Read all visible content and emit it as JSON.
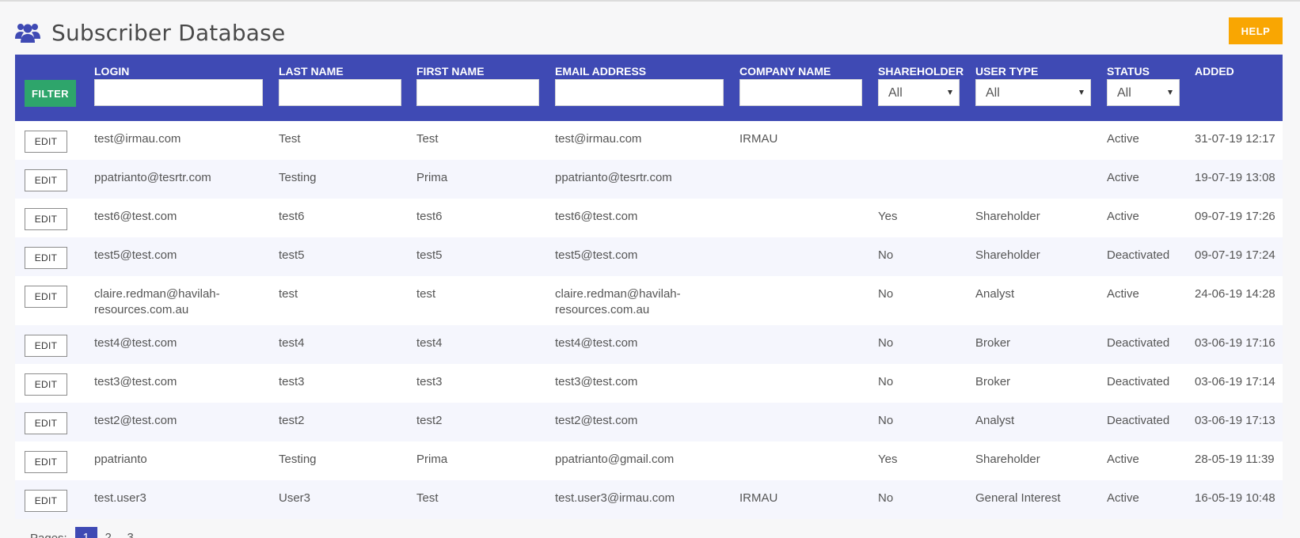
{
  "page": {
    "title": "Subscriber Database",
    "help_label": "HELP",
    "accent_color": "#3f4ab4",
    "filter_color": "#2ea56b",
    "help_color": "#f9a602"
  },
  "filters": {
    "filter_label": "FILTER",
    "columns": {
      "login": "LOGIN",
      "last_name": "LAST NAME",
      "first_name": "FIRST NAME",
      "email": "EMAIL ADDRESS",
      "company": "COMPANY NAME",
      "shareholder": "SHAREHOLDER",
      "user_type": "USER TYPE",
      "status": "STATUS",
      "added": "ADDED"
    },
    "values": {
      "login": "",
      "last_name": "",
      "first_name": "",
      "email": "",
      "company": "",
      "shareholder": "All",
      "user_type": "All",
      "status": "All"
    }
  },
  "table": {
    "edit_label": "EDIT",
    "rows": [
      {
        "login": "test@irmau.com",
        "last_name": "Test",
        "first_name": "Test",
        "email": "test@irmau.com",
        "company": "IRMAU",
        "shareholder": "",
        "user_type": "",
        "status": "Active",
        "added": "31-07-19 12:17"
      },
      {
        "login": "ppatrianto@tesrtr.com",
        "last_name": "Testing",
        "first_name": "Prima",
        "email": "ppatrianto@tesrtr.com",
        "company": "",
        "shareholder": "",
        "user_type": "",
        "status": "Active",
        "added": "19-07-19 13:08"
      },
      {
        "login": "test6@test.com",
        "last_name": "test6",
        "first_name": "test6",
        "email": "test6@test.com",
        "company": "",
        "shareholder": "Yes",
        "user_type": "Shareholder",
        "status": "Active",
        "added": "09-07-19 17:26"
      },
      {
        "login": "test5@test.com",
        "last_name": "test5",
        "first_name": "test5",
        "email": "test5@test.com",
        "company": "",
        "shareholder": "No",
        "user_type": "Shareholder",
        "status": "Deactivated",
        "added": "09-07-19 17:24"
      },
      {
        "login": "claire.redman@havilah-resources.com.au",
        "login_lines": [
          "claire.redman@havilah-",
          "resources.com.au"
        ],
        "last_name": "test",
        "first_name": "test",
        "email": "claire.redman@havilah-resources.com.au",
        "email_lines": [
          "claire.redman@havilah-",
          "resources.com.au"
        ],
        "company": "",
        "shareholder": "No",
        "user_type": "Analyst",
        "status": "Active",
        "added": "24-06-19 14:28"
      },
      {
        "login": "test4@test.com",
        "last_name": "test4",
        "first_name": "test4",
        "email": "test4@test.com",
        "company": "",
        "shareholder": "No",
        "user_type": "Broker",
        "status": "Deactivated",
        "added": "03-06-19 17:16"
      },
      {
        "login": "test3@test.com",
        "last_name": "test3",
        "first_name": "test3",
        "email": "test3@test.com",
        "company": "",
        "shareholder": "No",
        "user_type": "Broker",
        "status": "Deactivated",
        "added": "03-06-19 17:14"
      },
      {
        "login": "test2@test.com",
        "last_name": "test2",
        "first_name": "test2",
        "email": "test2@test.com",
        "company": "",
        "shareholder": "No",
        "user_type": "Analyst",
        "status": "Deactivated",
        "added": "03-06-19 17:13"
      },
      {
        "login": "ppatrianto",
        "last_name": "Testing",
        "first_name": "Prima",
        "email": "ppatrianto@gmail.com",
        "company": "",
        "shareholder": "Yes",
        "user_type": "Shareholder",
        "status": "Active",
        "added": "28-05-19 11:39"
      },
      {
        "login": "test.user3",
        "last_name": "User3",
        "first_name": "Test",
        "email": "test.user3@irmau.com",
        "company": "IRMAU",
        "shareholder": "No",
        "user_type": "General Interest",
        "status": "Active",
        "added": "16-05-19 10:48"
      }
    ]
  },
  "pagination": {
    "label": "Pages:",
    "pages": [
      "1",
      "2",
      "3"
    ],
    "current": "1"
  }
}
